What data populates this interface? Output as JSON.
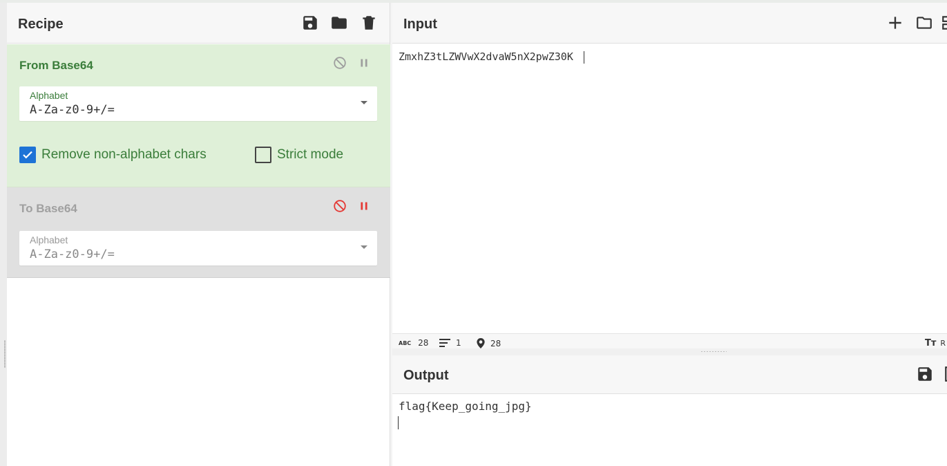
{
  "recipe": {
    "title": "Recipe",
    "operations": [
      {
        "name": "From Base64",
        "enabled": true,
        "field_label": "Alphabet",
        "field_value": "A-Za-z0-9+/=",
        "options": [
          {
            "label": "Remove non-alphabet chars",
            "checked": true
          },
          {
            "label": "Strict mode",
            "checked": false
          }
        ]
      },
      {
        "name": "To Base64",
        "enabled": false,
        "field_label": "Alphabet",
        "field_value": "A-Za-z0-9+/="
      }
    ]
  },
  "input": {
    "title": "Input",
    "text": "ZmxhZ3tLZWVwX2dvaW5nX2pwZ30K",
    "status": {
      "chars_icon_text": "ABC",
      "chars": "28",
      "lines": "1",
      "position": "28",
      "format_partial": "R"
    }
  },
  "output": {
    "title": "Output",
    "text": "flag{Keep_going_jpg}"
  },
  "colors": {
    "enabled_op_bg": "#dff0d8",
    "enabled_op_text": "#3a7d3a",
    "disabled_op_bg": "#e0e0e0",
    "disabled_icon": "#e53935",
    "checkbox_blue": "#1e73d6"
  },
  "icons": {
    "save": "save-icon",
    "open": "folder-icon",
    "clear": "trash-icon",
    "add": "plus-icon",
    "disable": "disable-icon",
    "pause": "pause-icon",
    "location": "location-pin-icon",
    "lines": "lines-icon",
    "font": "font-size-icon"
  }
}
